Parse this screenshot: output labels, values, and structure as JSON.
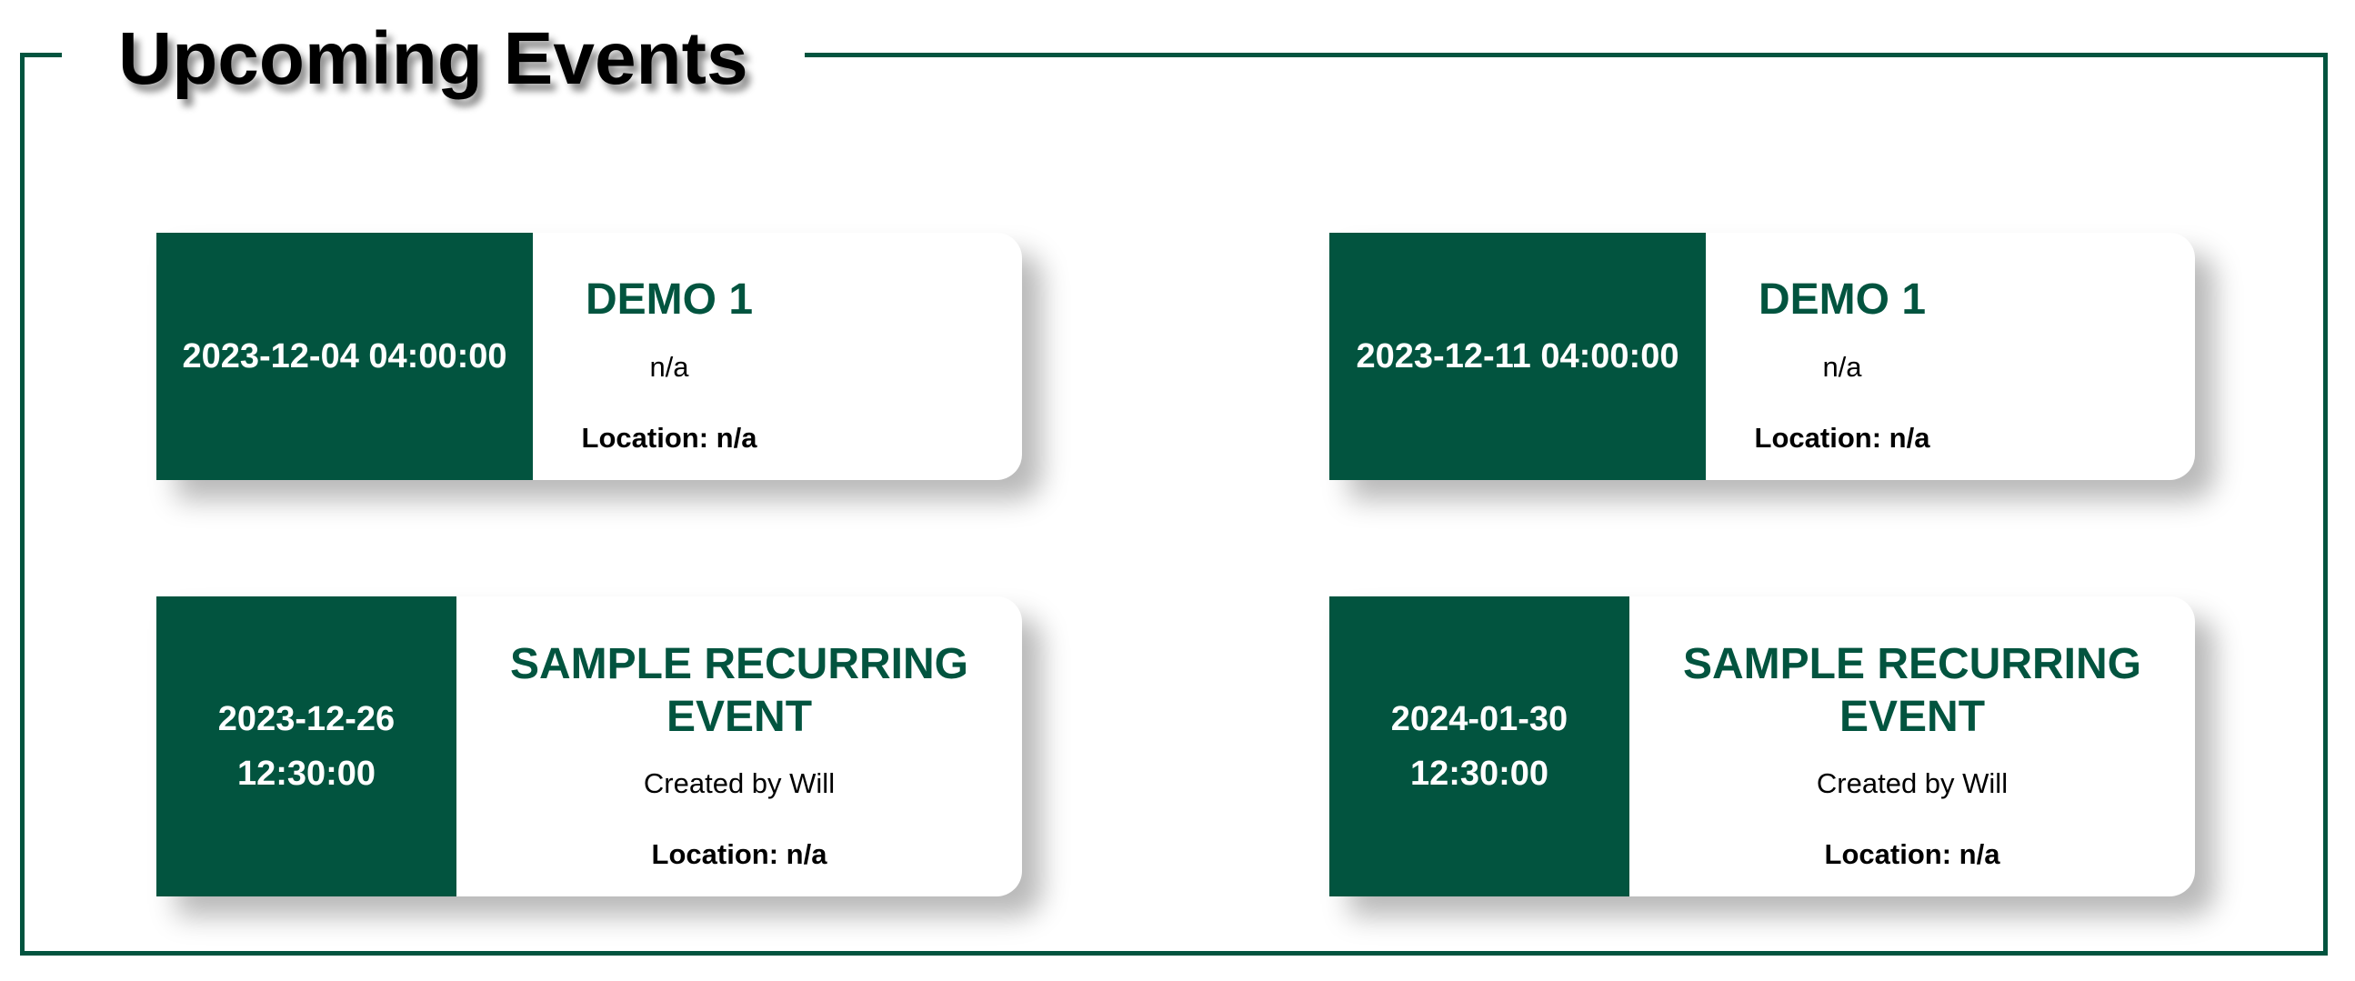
{
  "page": {
    "title": "Upcoming Events"
  },
  "colors": {
    "accent": "#02543f",
    "background": "#ffffff",
    "text": "#000000"
  },
  "events": [
    {
      "datetime": "2023-12-04 04:00:00",
      "title": "DEMO 1",
      "description": "n/a",
      "location": "Location: n/a"
    },
    {
      "datetime": "2023-12-11 04:00:00",
      "title": "DEMO 1",
      "description": "n/a",
      "location": "Location: n/a"
    },
    {
      "datetime": "2023-12-26 12:30:00",
      "title": "SAMPLE RECURRING EVENT",
      "description": "Created by Will",
      "location": "Location: n/a"
    },
    {
      "datetime": "2024-01-30 12:30:00",
      "title": "SAMPLE RECURRING EVENT",
      "description": "Created by Will",
      "location": "Location: n/a"
    }
  ]
}
